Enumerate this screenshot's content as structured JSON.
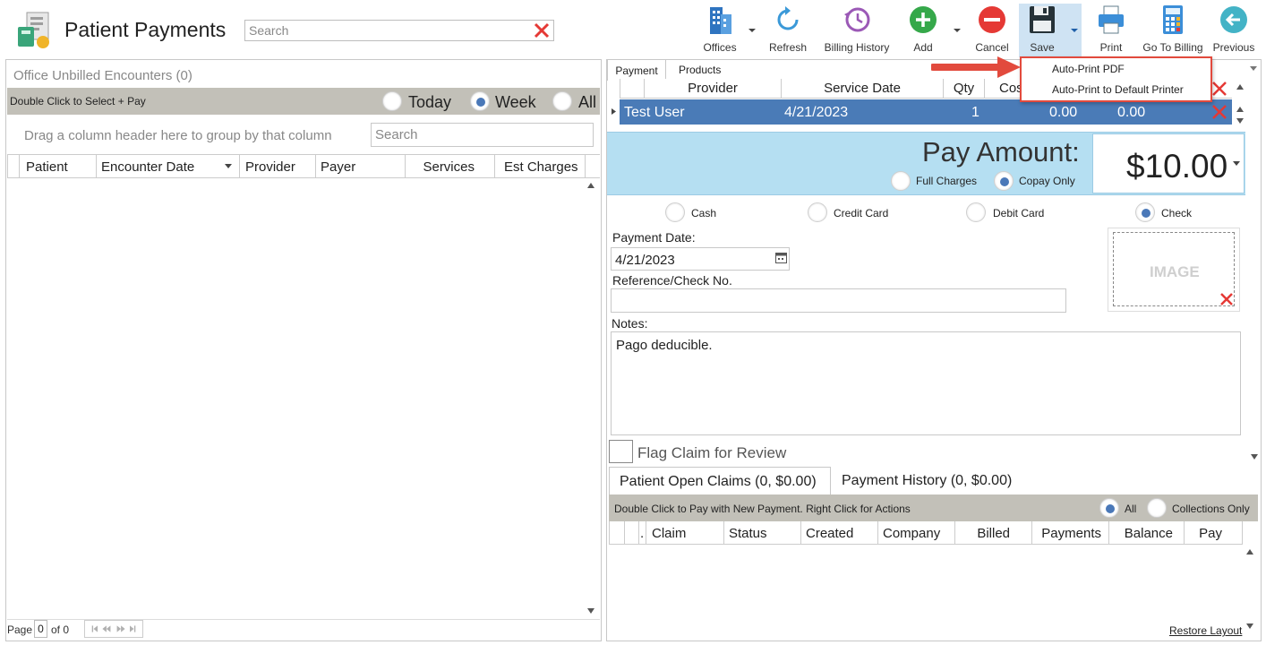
{
  "header": {
    "title": "Patient Payments",
    "search_placeholder": "Search"
  },
  "toolbar": {
    "offices": "Offices",
    "refresh": "Refresh",
    "billing_history": "Billing History",
    "add": "Add",
    "cancel": "Cancel",
    "save": "Save",
    "print": "Print",
    "go_to_billing": "Go To Billing",
    "previous": "Previous"
  },
  "save_menu": {
    "items": [
      "Auto-Print PDF",
      "Auto-Print to Default Printer"
    ]
  },
  "left": {
    "title": "Office Unbilled Encounters (0)",
    "bar_text": "Double Click to Select + Pay",
    "filters": [
      {
        "label": "Today",
        "selected": false
      },
      {
        "label": "Week",
        "selected": true
      },
      {
        "label": "All",
        "selected": false
      }
    ],
    "group_hint": "Drag a column header here to group by that column",
    "search_placeholder": "Search",
    "columns": [
      "Patient",
      "Encounter Date",
      "Provider",
      "Payer",
      "Services",
      "Est Charges"
    ],
    "pager": {
      "label": "Page",
      "page": "0",
      "of": "of 0"
    }
  },
  "right": {
    "tabs": [
      "Payment",
      "Products"
    ],
    "product_columns": [
      "Provider",
      "Service Date",
      "Qty",
      "Cost"
    ],
    "product_row": {
      "provider": "Test User",
      "service_date": "4/21/2023",
      "qty": "1",
      "cost": "0.00",
      "amount": "0.00"
    },
    "pay": {
      "label": "Pay Amount:",
      "value": "$10.00",
      "options": [
        {
          "label": "Full Charges",
          "selected": false
        },
        {
          "label": "Copay Only",
          "selected": true
        }
      ]
    },
    "methods": [
      {
        "label": "Cash",
        "selected": false
      },
      {
        "label": "Credit Card",
        "selected": false
      },
      {
        "label": "Debit Card",
        "selected": false
      },
      {
        "label": "Check",
        "selected": true
      }
    ],
    "payment_date_label": "Payment Date:",
    "payment_date": "4/21/2023",
    "reference_label": "Reference/Check No.",
    "reference_value": "",
    "notes_label": "Notes:",
    "notes": "Pago deducible.",
    "image_label": "IMAGE",
    "flag_label": "Flag Claim for Review",
    "bottom_tabs": [
      "Patient Open Claims (0, $0.00)",
      "Payment History (0, $0.00)"
    ],
    "claims_bar_text": "Double Click to Pay with New Payment. Right Click for Actions",
    "claims_filters": [
      {
        "label": "All",
        "selected": true
      },
      {
        "label": "Collections Only",
        "selected": false
      }
    ],
    "claims_columns": [
      ".",
      "Claim",
      "Status",
      "Created",
      "Company",
      "Billed",
      "Payments",
      "Balance",
      "Pay"
    ],
    "restore_layout": "Restore Layout"
  },
  "colors": {
    "accent_blue": "#4a7bb7",
    "pay_band": "#b5dff2",
    "bar_gray": "#c2c0b8",
    "clear_red": "#e53935",
    "callout_red": "#e24a3d"
  }
}
